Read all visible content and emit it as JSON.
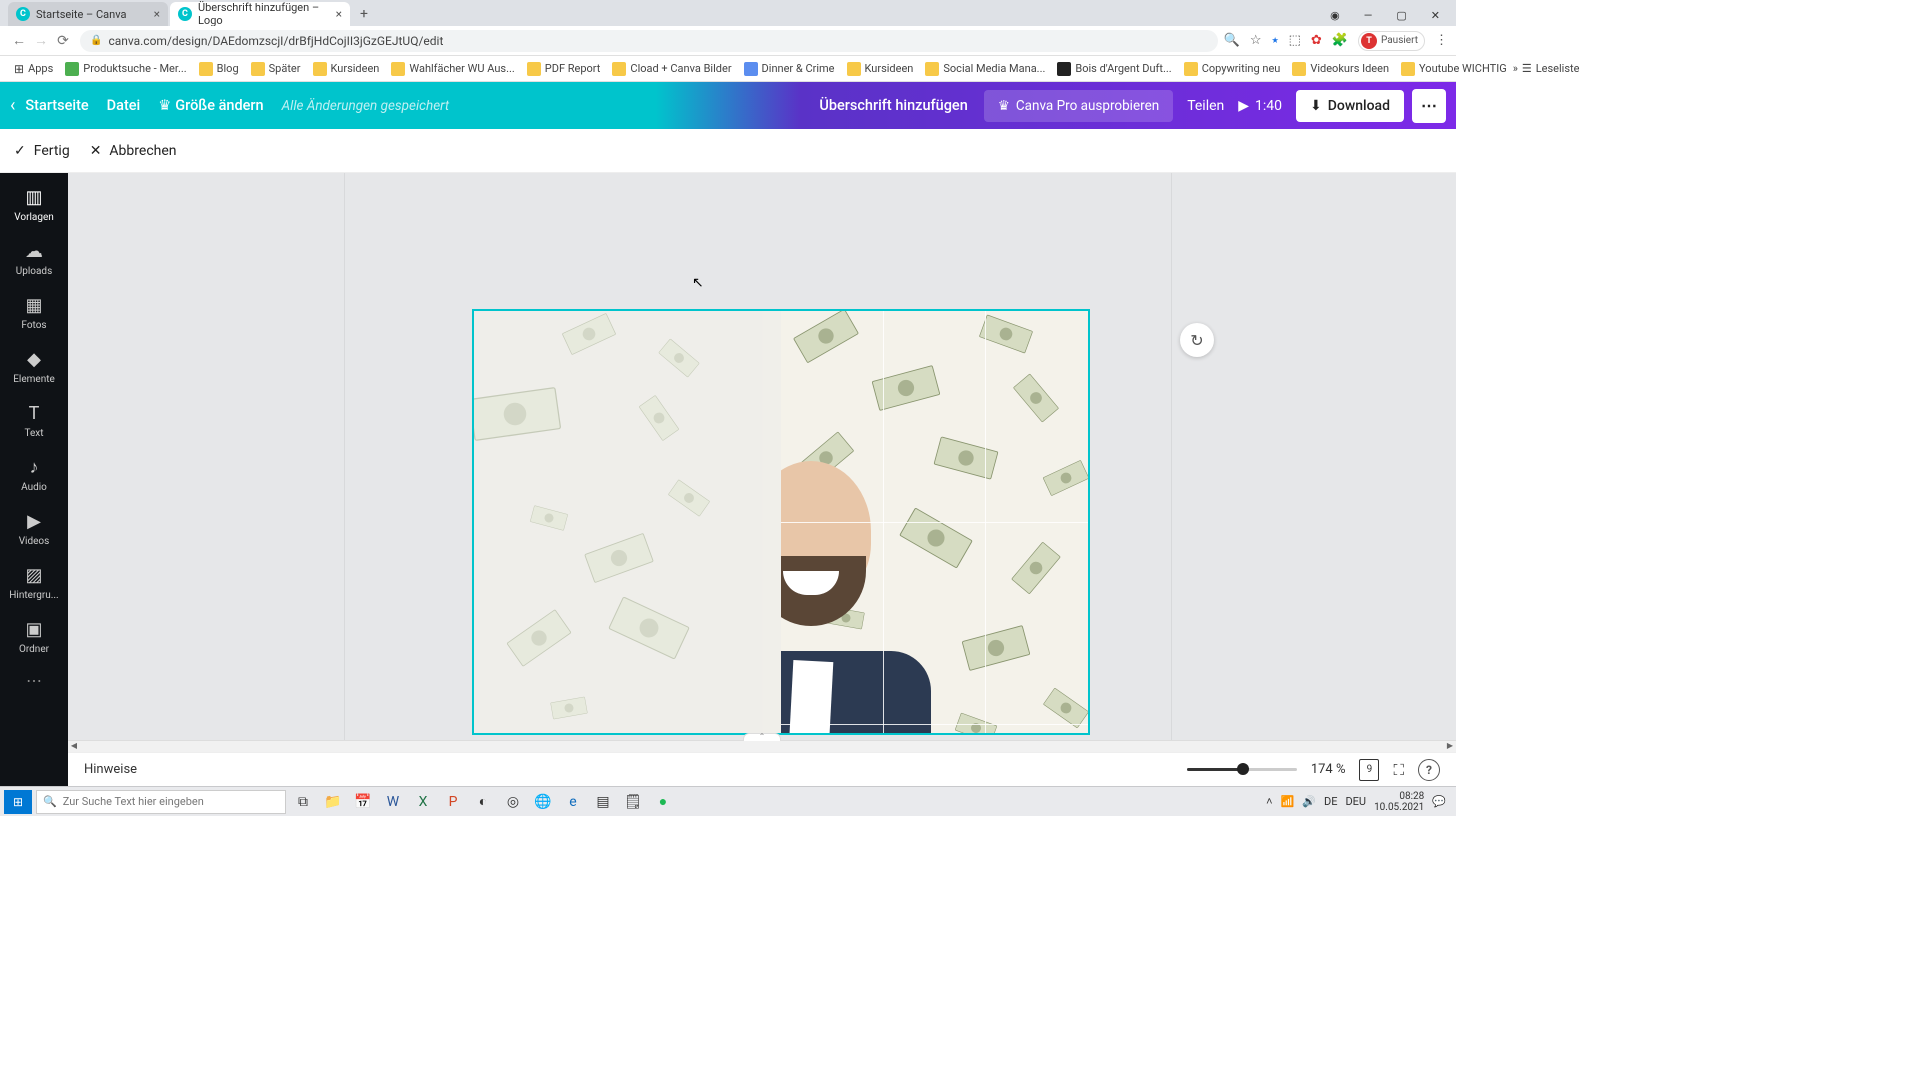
{
  "browser": {
    "tabs": [
      {
        "title": "Startseite – Canva",
        "active": false
      },
      {
        "title": "Überschrift hinzufügen – Logo",
        "active": true
      }
    ],
    "url": "canva.com/design/DAEdomzscjI/drBfjHdCojII3jGzGEJtUQ/edit",
    "profile_label": "Pausiert",
    "profile_initial": "T",
    "bookmarks": [
      "Apps",
      "Produktsuche - Mer...",
      "Blog",
      "Später",
      "Kursideen",
      "Wahlfächer WU Aus...",
      "PDF Report",
      "Cload + Canva Bilder",
      "Dinner & Crime",
      "Kursideen",
      "Social Media Mana...",
      "Bois d'Argent Duft...",
      "Copywriting neu",
      "Videokurs Ideen",
      "Youtube WICHTIG"
    ],
    "reading_list": "Leseliste"
  },
  "canva_header": {
    "home": "Startseite",
    "file": "Datei",
    "resize": "Größe ändern",
    "saved": "Alle Änderungen gespeichert",
    "doc_title": "Überschrift hinzufügen",
    "try_pro": "Canva Pro ausprobieren",
    "share": "Teilen",
    "play_time": "1:40",
    "download": "Download"
  },
  "crop_bar": {
    "done": "Fertig",
    "cancel": "Abbrechen"
  },
  "sidebar": {
    "items": [
      "Vorlagen",
      "Uploads",
      "Fotos",
      "Elemente",
      "Text",
      "Audio",
      "Videos",
      "Hintergru...",
      "Ordner"
    ]
  },
  "canvas": {
    "refresh_icon": "↻"
  },
  "footer": {
    "notes": "Hinweise",
    "zoom_percent": "174 %",
    "page_count": "9"
  },
  "taskbar": {
    "search_placeholder": "Zur Suche Text hier eingeben",
    "lang": "DEU",
    "time": "08:28",
    "date": "10.05.2021",
    "keyboard": "DE"
  }
}
